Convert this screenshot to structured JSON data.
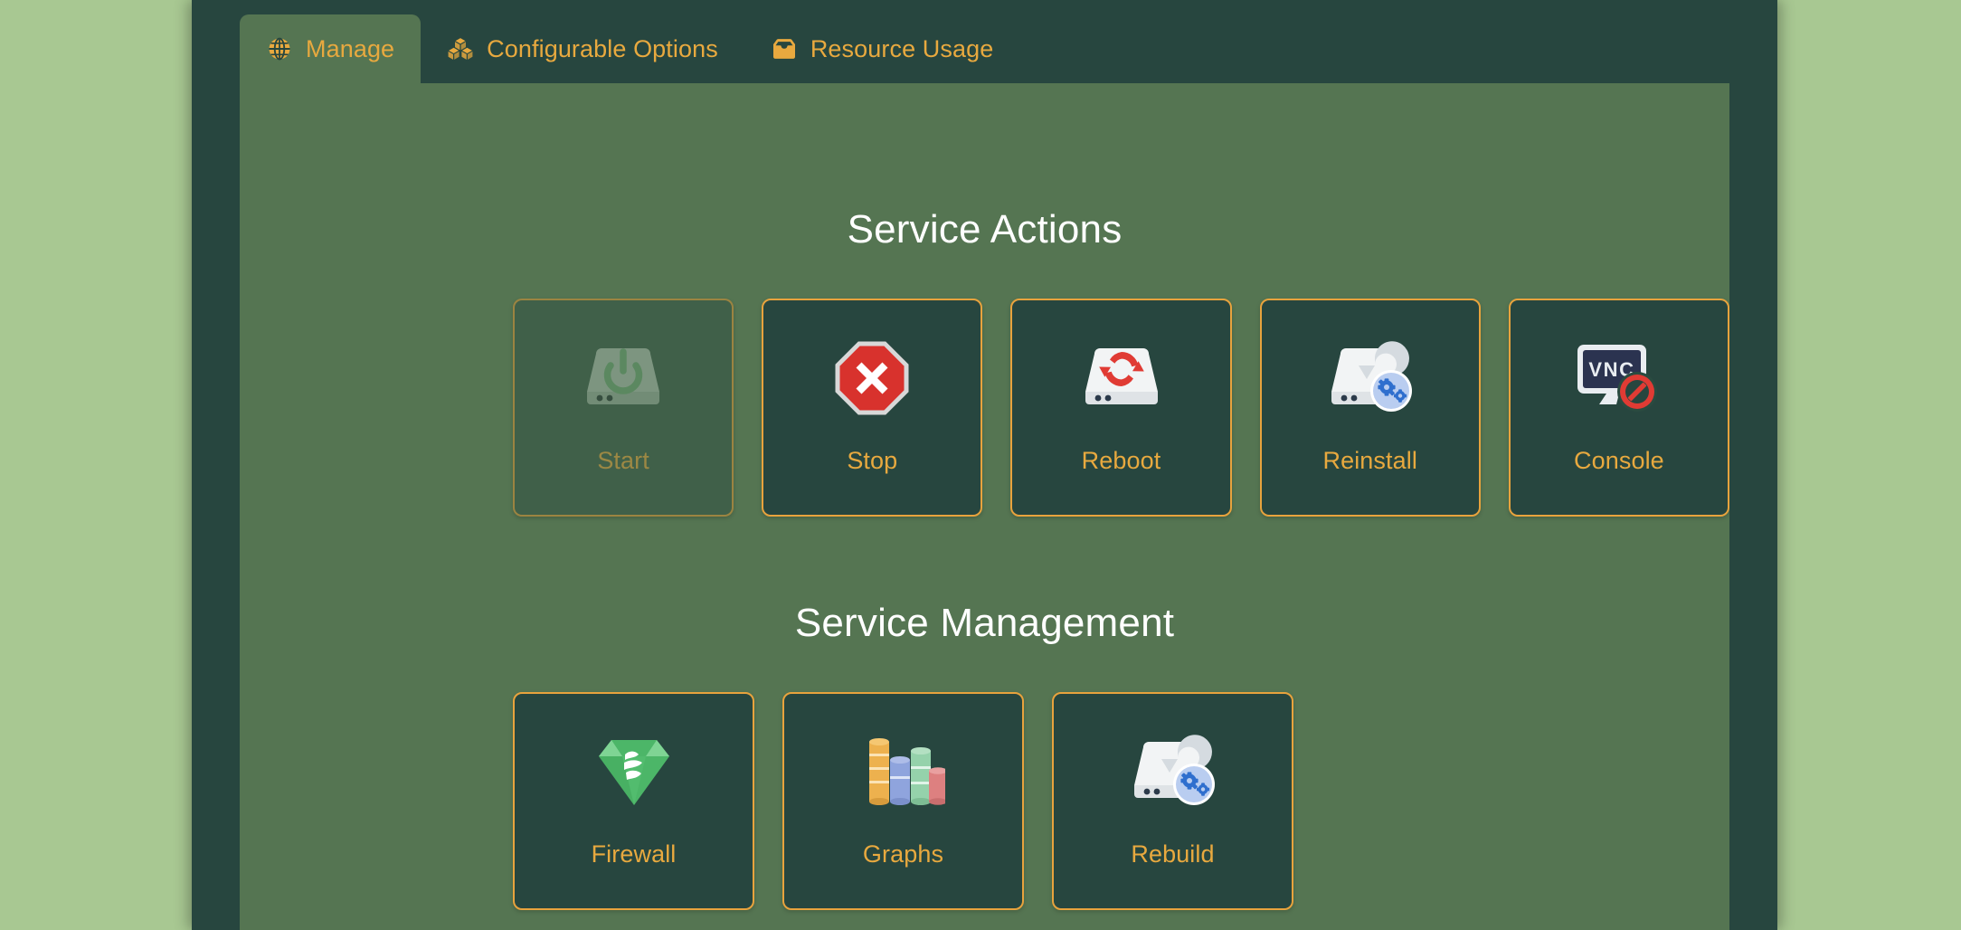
{
  "colors": {
    "page_background": "#a8c892",
    "shell_background": "#27463f",
    "content_background": "#557552",
    "accent": "#e8a93f",
    "card_border": "#e8a33d",
    "card_background": "#27463f",
    "heading_text": "#ffffff"
  },
  "tabs": [
    {
      "label": "Manage",
      "icon": "globe-icon",
      "active": true
    },
    {
      "label": "Configurable Options",
      "icon": "boxes-icon",
      "active": false
    },
    {
      "label": "Resource Usage",
      "icon": "inbox-icon",
      "active": false
    }
  ],
  "sections": [
    {
      "title": "Service Actions",
      "cards": [
        {
          "label": "Start",
          "icon": "server-power-icon",
          "disabled": true
        },
        {
          "label": "Stop",
          "icon": "stop-octagon-icon",
          "disabled": false
        },
        {
          "label": "Reboot",
          "icon": "server-refresh-icon",
          "disabled": false
        },
        {
          "label": "Reinstall",
          "icon": "server-gear-icon",
          "disabled": false
        },
        {
          "label": "Console",
          "icon": "vnc-blocked-icon",
          "disabled": false
        }
      ]
    },
    {
      "title": "Service Management",
      "cards": [
        {
          "label": "Firewall",
          "icon": "gem-shield-icon",
          "disabled": false
        },
        {
          "label": "Graphs",
          "icon": "bar-chart-3d-icon",
          "disabled": false
        },
        {
          "label": "Rebuild",
          "icon": "server-gear-icon",
          "disabled": false
        }
      ]
    }
  ]
}
